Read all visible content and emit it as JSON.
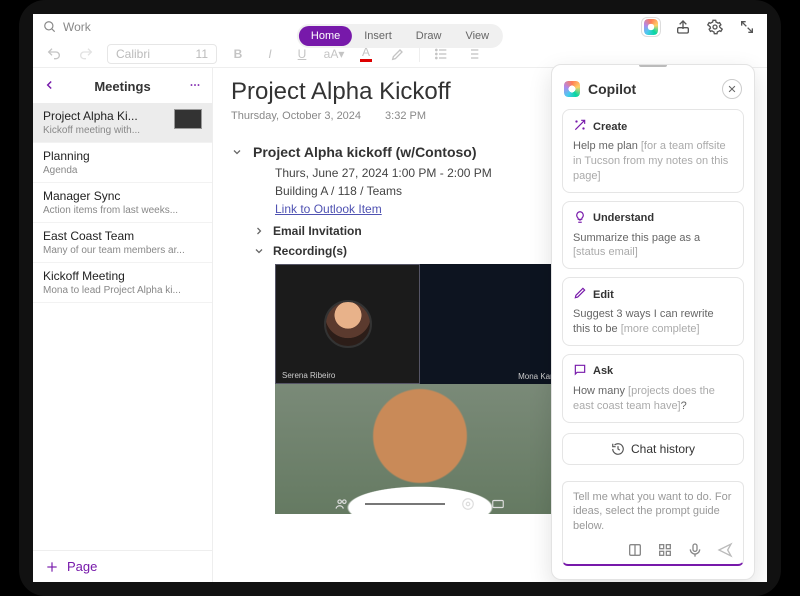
{
  "search": {
    "value": "Work"
  },
  "tabs": {
    "items": [
      "Home",
      "Insert",
      "Draw",
      "View"
    ],
    "active": 0
  },
  "fmt": {
    "font": "Calibri",
    "size": "11"
  },
  "sidebar": {
    "section": "Meetings",
    "items": [
      {
        "title": "Project Alpha Ki...",
        "sub": "Kickoff meeting with...",
        "selected": true,
        "thumb": true
      },
      {
        "title": "Planning",
        "sub": "Agenda"
      },
      {
        "title": "Manager Sync",
        "sub": "Action items from last weeks..."
      },
      {
        "title": "East Coast Team",
        "sub": "Many of our team members ar..."
      },
      {
        "title": "Kickoff Meeting",
        "sub": "Mona to lead Project Alpha ki..."
      }
    ],
    "add": "Page"
  },
  "note": {
    "title": "Project Alpha Kickoff",
    "date": "Thursday, October 3, 2024",
    "time": "3:32 PM",
    "meeting": {
      "title": "Project Alpha kickoff (w/Contoso)",
      "when": "Thurs, June 27, 2024 1:00 PM - 2:00 PM",
      "where": "Building A / 118 / Teams",
      "link": "Link to Outlook Item"
    },
    "email_section": "Email Invitation",
    "rec_section": "Recording(s)",
    "participants": [
      "Serena Ribeiro",
      "Mona Kane"
    ]
  },
  "copilot": {
    "title": "Copilot",
    "cards": [
      {
        "icon": "wand",
        "title": "Create",
        "text": "Help me plan ",
        "hint": "[for a team offsite in Tucson from my notes on this page]"
      },
      {
        "icon": "bulb",
        "title": "Understand",
        "text": "Summarize this page as a ",
        "hint": "[status email]"
      },
      {
        "icon": "pencil",
        "title": "Edit",
        "text": "Suggest 3 ways I can rewrite this to be ",
        "hint": "[more complete]"
      },
      {
        "icon": "chat",
        "title": "Ask",
        "text": "How many ",
        "hint": "[projects does the east coast team have]",
        "suffix": "?"
      }
    ],
    "history": "Chat history",
    "placeholder": "Tell me what you want to do. For ideas, select the prompt guide below."
  }
}
